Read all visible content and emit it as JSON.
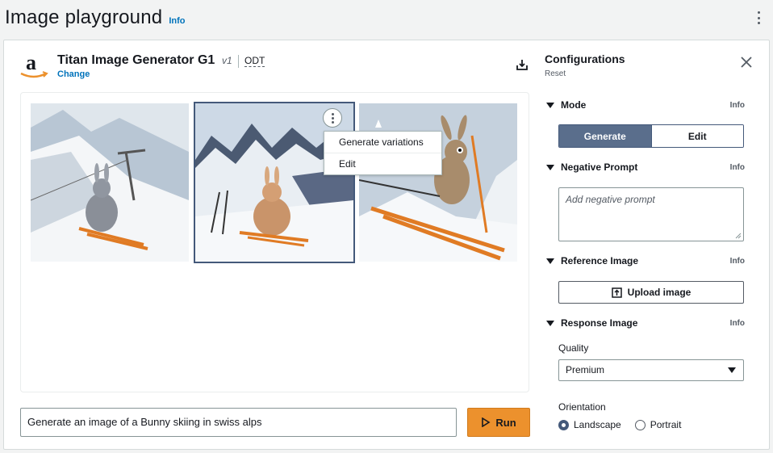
{
  "page": {
    "title": "Image playground",
    "info": "Info"
  },
  "model": {
    "name": "Titan Image Generator G1",
    "version": "v1",
    "badge": "ODT",
    "change": "Change"
  },
  "images": [
    {
      "id": "image-1",
      "alt": ""
    },
    {
      "id": "image-2",
      "alt": ""
    },
    {
      "id": "image-3",
      "alt": ""
    }
  ],
  "context_menu": {
    "items": [
      "Generate variations",
      "Edit"
    ]
  },
  "prompt": {
    "value": "Generate an image of a Bunny skiing in swiss alps"
  },
  "run_button": {
    "label": "Run"
  },
  "config": {
    "title": "Configurations",
    "reset": "Reset",
    "mode": {
      "label": "Mode",
      "info": "Info",
      "options": [
        "Generate",
        "Edit"
      ],
      "selected": "Generate"
    },
    "negative_prompt": {
      "label": "Negative Prompt",
      "info": "Info",
      "placeholder": "Add negative prompt"
    },
    "reference_image": {
      "label": "Reference Image",
      "info": "Info",
      "upload_label": "Upload image"
    },
    "response_image": {
      "label": "Response Image",
      "info": "Info",
      "quality_label": "Quality",
      "quality_value": "Premium",
      "orientation_label": "Orientation",
      "orientation_options": [
        "Landscape",
        "Portrait"
      ],
      "orientation_selected": "Landscape"
    }
  },
  "colors": {
    "accent": "#44597a",
    "run": "#ec912d",
    "link": "#0073bb"
  }
}
